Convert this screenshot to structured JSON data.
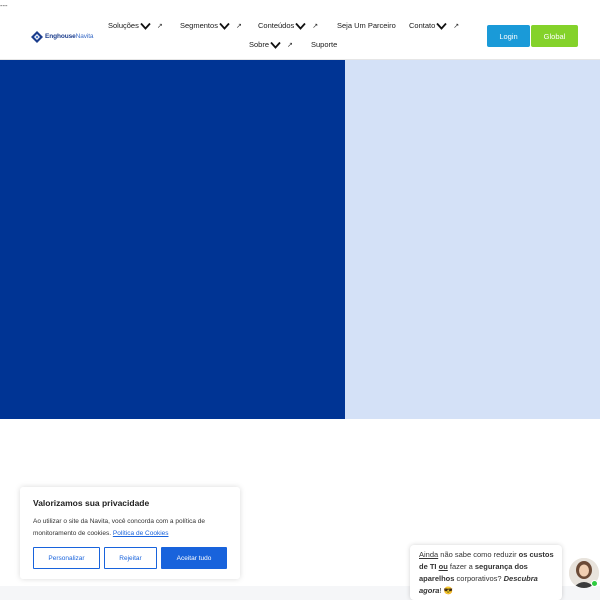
{
  "top_text": "---",
  "logo": {
    "brand": "Enghouse",
    "product": "Navita"
  },
  "nav": {
    "items": [
      {
        "label": "Soluções"
      },
      {
        "label": "Segmentos"
      },
      {
        "label": "Conteúdos"
      },
      {
        "label": "Seja Um Parceiro"
      },
      {
        "label": "Contato"
      },
      {
        "label": "Sobre"
      },
      {
        "label": "Suporte"
      }
    ],
    "external_arrow": "↗"
  },
  "buttons": {
    "login": "Login",
    "global": "Global"
  },
  "colors": {
    "hero_left": "#003494",
    "hero_right": "#d4e1f7",
    "login": "#1a9ad8",
    "global": "#84d22a",
    "cookie_accent": "#1863dc"
  },
  "cookie": {
    "title": "Valorizamos sua privacidade",
    "text": "Ao utilizar o site da Navita, você concorda com a política de monitoramento de cookies.",
    "link": "Política de Cookies",
    "customize": "Personalizar",
    "reject": "Rejeitar",
    "accept": "Aceitar tudo"
  },
  "chat": {
    "t1": "Ainda",
    "t2": " não sabe como reduzir ",
    "t3": "os custos de TI",
    "t4": " ",
    "t5": "ou",
    "t6": " fazer a ",
    "t7": "segurança dos aparelhos",
    "t8": " corporativos? ",
    "t9": "Descubra agora",
    "t10": "! 😎"
  }
}
